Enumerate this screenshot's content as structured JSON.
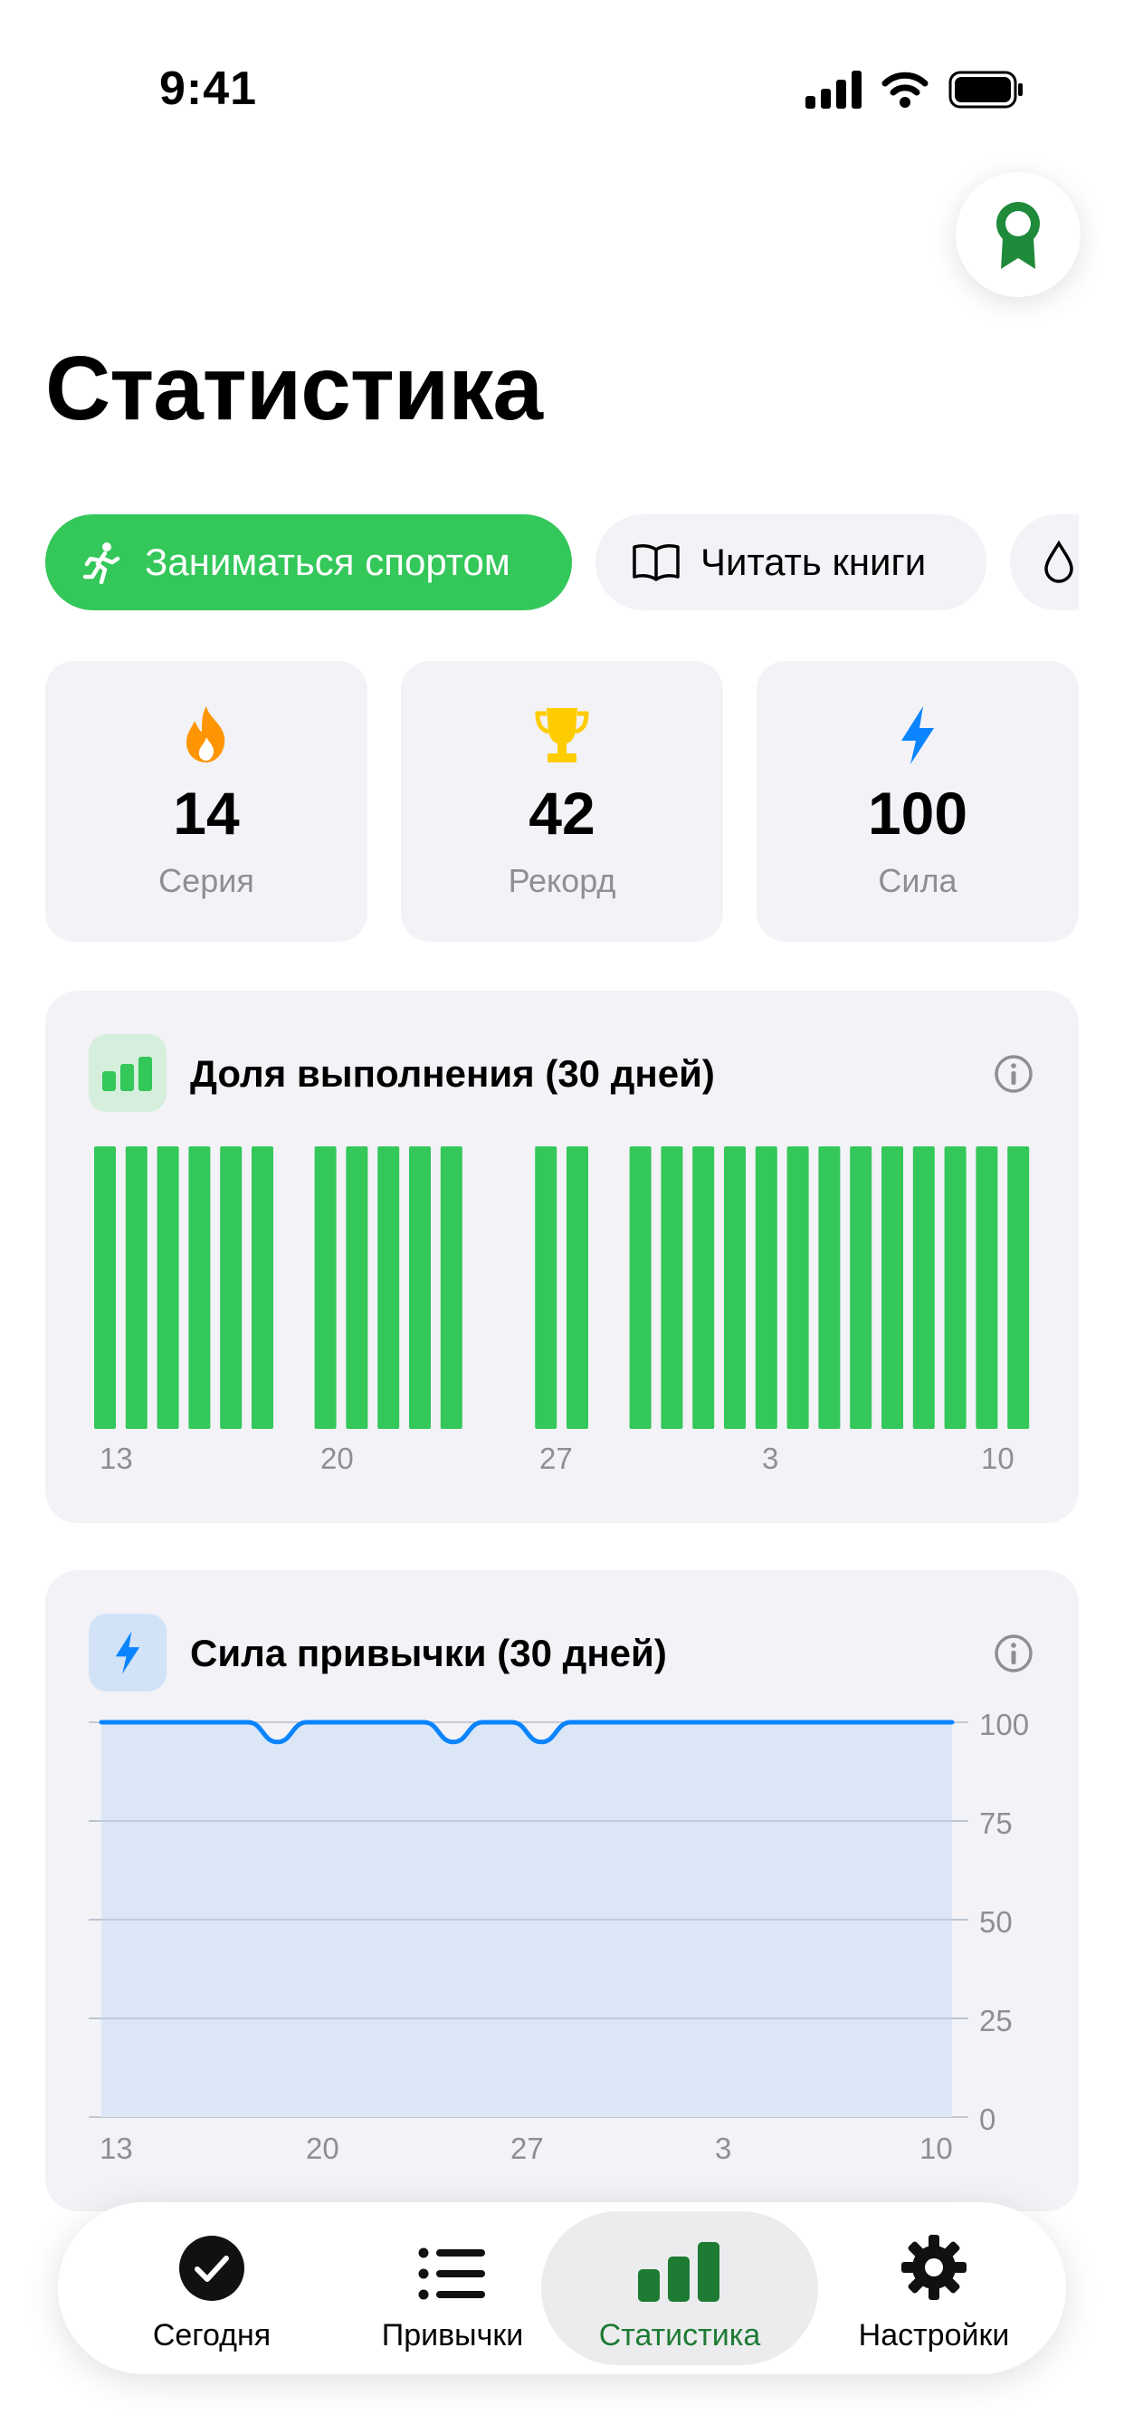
{
  "status_bar": {
    "time": "9:41"
  },
  "page_title": "Статистика",
  "habit_chips": [
    {
      "label": "Заниматься спортом",
      "icon": "figure-run-icon",
      "active": true
    },
    {
      "label": "Читать книги",
      "icon": "book-icon",
      "active": false
    },
    {
      "label": "",
      "icon": "drop-icon",
      "active": false
    }
  ],
  "stats": [
    {
      "value": "14",
      "label": "Серия",
      "icon": "flame-icon",
      "color": "#ff9500"
    },
    {
      "value": "42",
      "label": "Рекорд",
      "icon": "trophy-icon",
      "color": "#ffcc00"
    },
    {
      "value": "100",
      "label": "Сила",
      "icon": "bolt-icon",
      "color": "#0a84ff"
    }
  ],
  "completion_card": {
    "title": "Доля выполнения (30 дней)"
  },
  "strength_card": {
    "title": "Сила привычки (30 дней)"
  },
  "chart_data": [
    {
      "type": "bar",
      "title": "Доля выполнения (30 дней)",
      "x_tick_labels": [
        "13",
        "20",
        "27",
        "3",
        "10"
      ],
      "categories": [
        "13",
        "14",
        "15",
        "16",
        "17",
        "18",
        "19",
        "20",
        "21",
        "22",
        "23",
        "24",
        "25",
        "26",
        "27",
        "28",
        "29",
        "30",
        "1",
        "2",
        "3",
        "4",
        "5",
        "6",
        "7",
        "8",
        "9",
        "10",
        "11",
        "12"
      ],
      "values": [
        1,
        1,
        1,
        1,
        1,
        1,
        0,
        1,
        1,
        1,
        1,
        1,
        0,
        0,
        1,
        1,
        0,
        1,
        1,
        1,
        1,
        1,
        1,
        1,
        1,
        1,
        1,
        1,
        1,
        1
      ],
      "ylim": [
        0,
        1
      ],
      "color": "#34c759"
    },
    {
      "type": "area",
      "title": "Сила привычки (30 дней)",
      "x_tick_labels": [
        "13",
        "20",
        "27",
        "3",
        "10"
      ],
      "y_tick_labels": [
        "100",
        "75",
        "50",
        "25",
        "0"
      ],
      "x": [
        0,
        1,
        2,
        3,
        4,
        5,
        6,
        7,
        8,
        9,
        10,
        11,
        12,
        13,
        14,
        15,
        16,
        17,
        18,
        19,
        20,
        21,
        22,
        23,
        24,
        25,
        26,
        27,
        28,
        29
      ],
      "values": [
        100,
        100,
        100,
        100,
        100,
        100,
        95,
        100,
        100,
        100,
        100,
        100,
        95,
        100,
        100,
        95,
        100,
        100,
        100,
        100,
        100,
        100,
        100,
        100,
        100,
        100,
        100,
        100,
        100,
        100
      ],
      "ylim": [
        0,
        100
      ],
      "grid": true,
      "line_color": "#0a84ff",
      "fill_color": "#dbe7f7"
    }
  ],
  "tabs": [
    {
      "label": "Сегодня",
      "icon": "checkmark-circle-icon",
      "active": false
    },
    {
      "label": "Привычки",
      "icon": "list-icon",
      "active": false
    },
    {
      "label": "Статистика",
      "icon": "chart-bar-icon",
      "active": true
    },
    {
      "label": "Настройки",
      "icon": "gear-icon",
      "active": false
    }
  ],
  "colors": {
    "accent": "#34c759",
    "active_tab_text": "#1e7b34",
    "blue": "#0a84ff"
  }
}
